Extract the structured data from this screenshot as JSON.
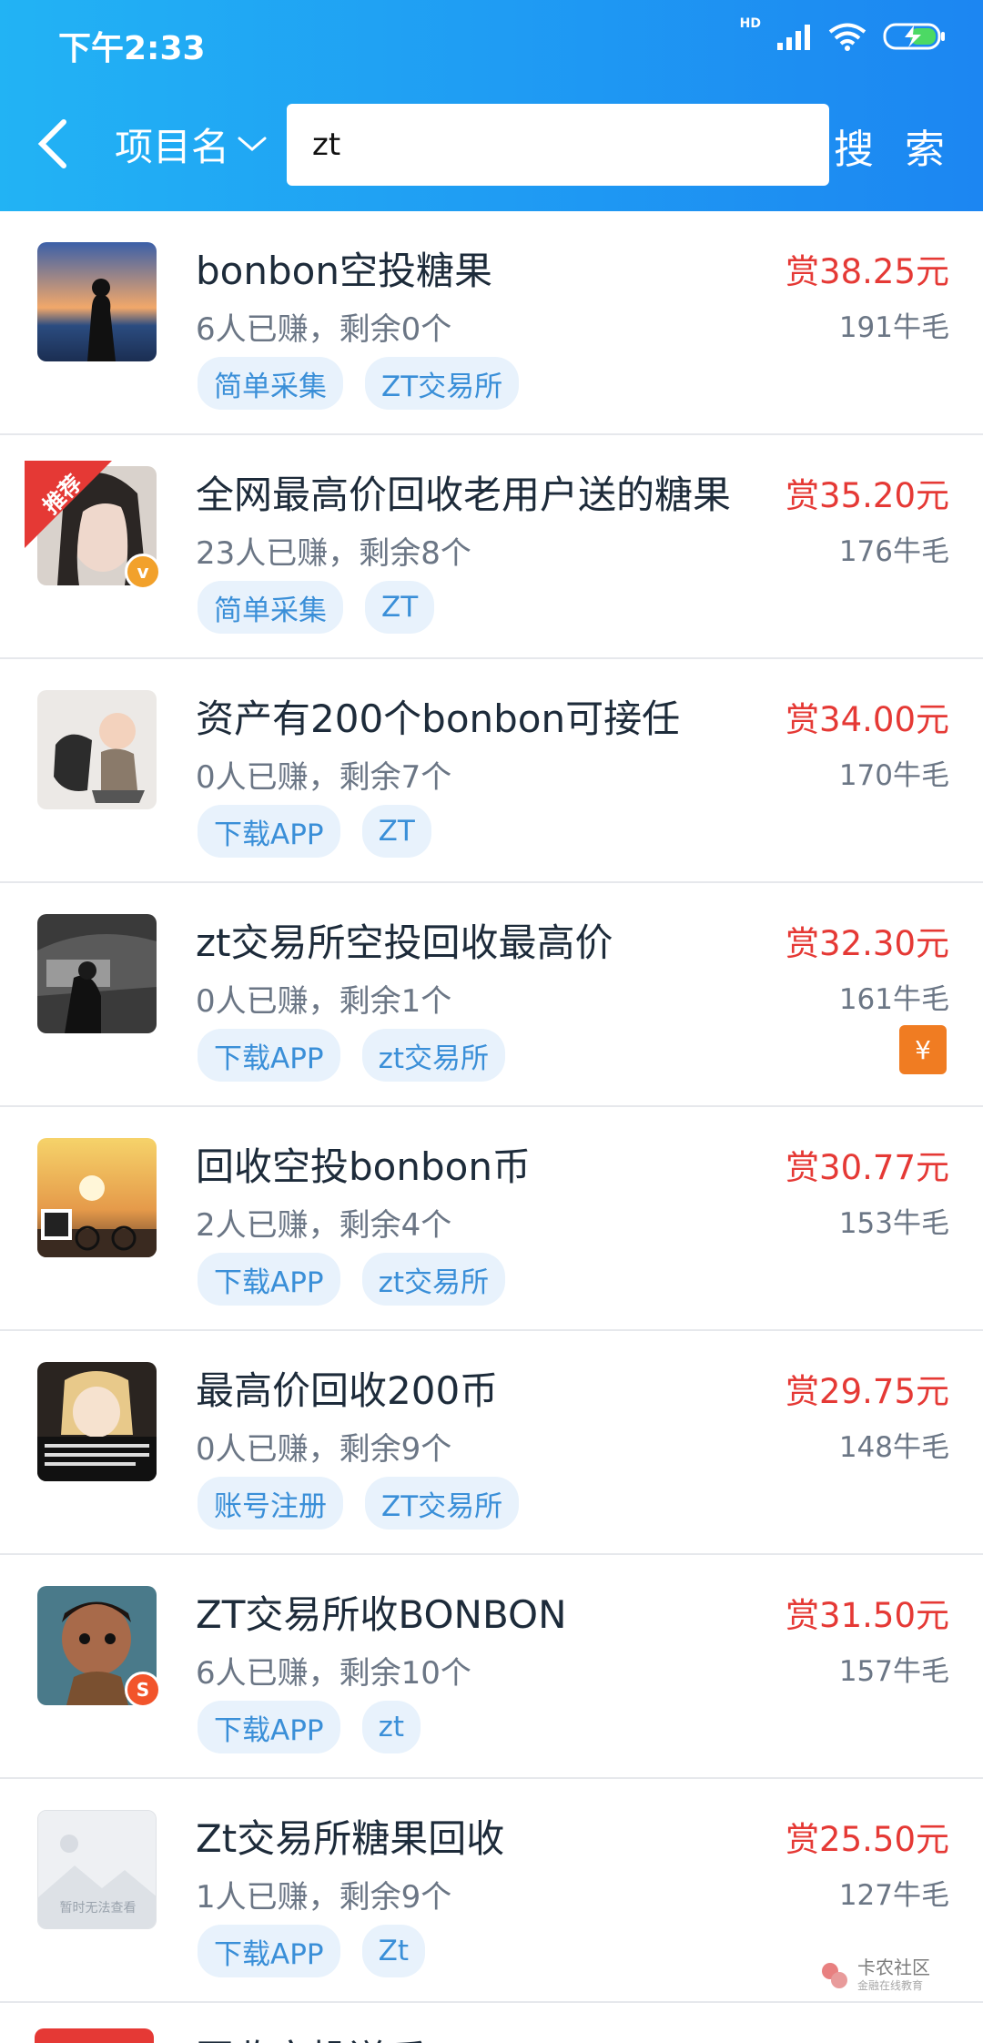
{
  "status": {
    "time": "下午2:33",
    "network": "HD"
  },
  "header": {
    "filter_label": "项目名",
    "search_value": "zt",
    "search_button": "搜 索"
  },
  "items": [
    {
      "title": "bonbon空投糖果",
      "meta": "6人已赚，剩余0个",
      "tags": [
        "简单采集",
        "ZT交易所"
      ],
      "reward": "赏38.25元",
      "points": "191牛毛"
    },
    {
      "title": "全网最高价回收老用户送的糖果",
      "meta": "23人已赚，剩余8个",
      "tags": [
        "简单采集",
        "ZT"
      ],
      "reward": "赏35.20元",
      "points": "176牛毛",
      "badge": "推荐",
      "vip": "v"
    },
    {
      "title": "资产有200个bonbon可接任",
      "meta": "0人已赚，剩余7个",
      "tags": [
        "下载APP",
        "ZT"
      ],
      "reward": "赏34.00元",
      "points": "170牛毛"
    },
    {
      "title": "zt交易所空投回收最高价",
      "meta": "0人已赚，剩余1个",
      "tags": [
        "下载APP",
        "zt交易所"
      ],
      "reward": "赏32.30元",
      "points": "161牛毛",
      "redpack": "¥"
    },
    {
      "title": "回收空投bonbon币",
      "meta": "2人已赚，剩余4个",
      "tags": [
        "下载APP",
        "zt交易所"
      ],
      "reward": "赏30.77元",
      "points": "153牛毛"
    },
    {
      "title": "最高价回收200币",
      "meta": "0人已赚，剩余9个",
      "tags": [
        "账号注册",
        "ZT交易所"
      ],
      "reward": "赏29.75元",
      "points": "148牛毛"
    },
    {
      "title": "ZT交易所收BONBON",
      "meta": "6人已赚，剩余10个",
      "tags": [
        "下载APP",
        "zt"
      ],
      "reward": "赏31.50元",
      "points": "157牛毛",
      "s_badge": "S"
    },
    {
      "title": "Zt交易所糖果回收",
      "meta": "1人已赚，剩余9个",
      "tags": [
        "下载APP",
        "Zt"
      ],
      "reward": "赏25.50元",
      "points": "127牛毛",
      "placeholder_text": "暂时无法查看"
    }
  ],
  "partial_item": {
    "title": "回收空投送币"
  },
  "watermark": {
    "title": "卡农社区",
    "subtitle": "金融在线教育"
  },
  "colors": {
    "header_start": "#22b3f4",
    "header_end": "#1c86f2",
    "reward": "#e53935",
    "tag_bg": "#e8f2fc",
    "tag_text": "#3a8fd8"
  }
}
